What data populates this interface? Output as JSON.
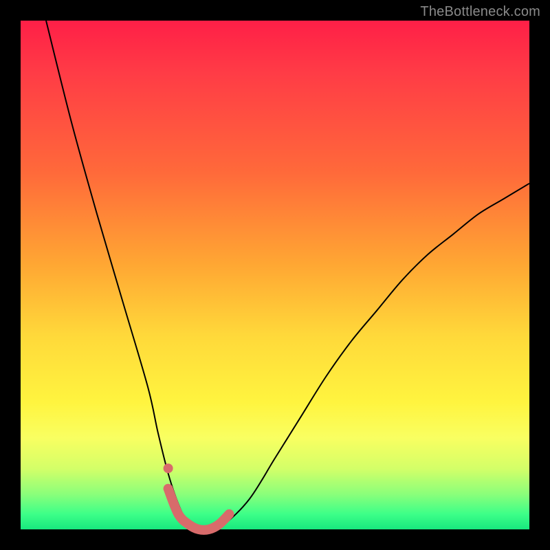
{
  "watermark": "TheBottleneck.com",
  "chart_data": {
    "type": "line",
    "title": "",
    "xlabel": "",
    "ylabel": "",
    "xlim": [
      0,
      100
    ],
    "ylim": [
      0,
      100
    ],
    "legend": false,
    "grid": false,
    "background_gradient": {
      "direction": "vertical",
      "stops": [
        {
          "pos": 0,
          "color": "#ff1f47"
        },
        {
          "pos": 50,
          "color": "#ffc13a"
        },
        {
          "pos": 80,
          "color": "#fff23f"
        },
        {
          "pos": 100,
          "color": "#18e87e"
        }
      ]
    },
    "series": [
      {
        "name": "bottleneck-curve",
        "color": "#000000",
        "stroke_width": 2,
        "x": [
          5,
          10,
          15,
          20,
          25,
          27,
          29,
          31,
          33,
          35,
          37,
          40,
          45,
          50,
          55,
          60,
          65,
          70,
          75,
          80,
          85,
          90,
          95,
          100
        ],
        "values": [
          100,
          80,
          62,
          45,
          28,
          19,
          11,
          5,
          1,
          0,
          0,
          1,
          6,
          14,
          22,
          30,
          37,
          43,
          49,
          54,
          58,
          62,
          65,
          68
        ]
      },
      {
        "name": "highlight-band",
        "color": "#d86b6b",
        "stroke_width": 14,
        "x": [
          29,
          31,
          33,
          35,
          37,
          39,
          41
        ],
        "values": [
          8,
          3,
          1,
          0,
          0,
          1,
          3
        ]
      },
      {
        "name": "highlight-dot",
        "type": "scatter",
        "color": "#d86b6b",
        "radius": 7,
        "x": [
          29
        ],
        "values": [
          12
        ]
      }
    ],
    "annotations": []
  }
}
